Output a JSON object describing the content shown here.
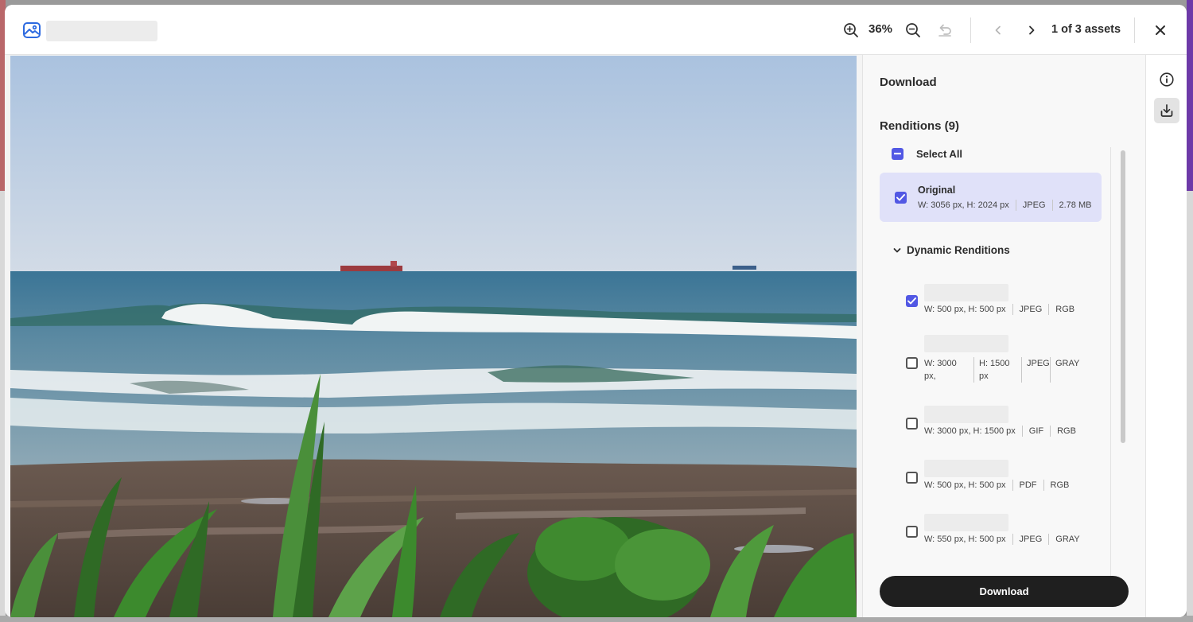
{
  "header": {
    "zoom_level": "36%",
    "pager_text": "1 of 3 assets",
    "icons": {
      "app": "image-icon",
      "zoom_in": "zoom-in-icon",
      "zoom_out": "zoom-out-icon",
      "reset": "undo-icon",
      "prev": "chevron-left-icon",
      "next": "chevron-right-icon",
      "close": "close-icon"
    }
  },
  "panel": {
    "title": "Download",
    "renditions_title": "Renditions (9)",
    "select_all_label": "Select All",
    "select_all_state": "mixed",
    "original": {
      "name": "Original",
      "checked": true,
      "dimensions": "W: 3056 px, H: 2024 px",
      "format": "JPEG",
      "size": "2.78 MB"
    },
    "dynamic_title": "Dynamic Renditions",
    "dynamic": [
      {
        "checked": true,
        "dimensions": "W: 500 px, H: 500 px",
        "format": "JPEG",
        "color": "RGB"
      },
      {
        "checked": false,
        "width_text": "W: 3000 px,",
        "height_text": "H: 1500 px",
        "format": "JPEG",
        "color": "GRAY"
      },
      {
        "checked": false,
        "dimensions": "W: 3000 px, H: 1500 px",
        "format": "GIF",
        "color": "RGB"
      },
      {
        "checked": false,
        "dimensions": "W: 500 px, H: 500 px",
        "format": "PDF",
        "color": "RGB"
      },
      {
        "checked": false,
        "dimensions": "W: 550 px, H: 500 px",
        "format": "JPEG",
        "color": "GRAY"
      }
    ],
    "download_label": "Download"
  },
  "rail": {
    "info_icon": "info-icon",
    "download_icon": "download-icon"
  },
  "colors": {
    "accent": "#5258e4",
    "selected_row": "#e0e1f9",
    "button": "#1f1f1f"
  }
}
